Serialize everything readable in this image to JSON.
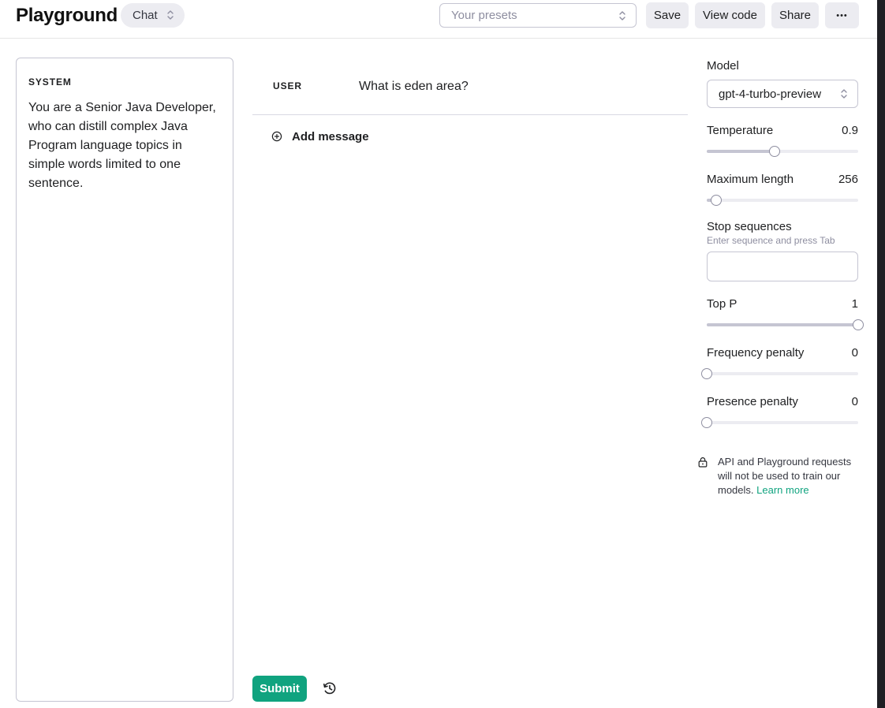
{
  "header": {
    "title": "Playground",
    "mode": "Chat",
    "presets_placeholder": "Your presets",
    "save_label": "Save",
    "view_code_label": "View code",
    "share_label": "Share",
    "more_label": "•••"
  },
  "system": {
    "label": "SYSTEM",
    "text": "You are a Senior Java Developer, who can distill complex Java Program language topics in simple words limited to one sentence."
  },
  "messages": [
    {
      "role": "USER",
      "content": "What is eden area?"
    }
  ],
  "add_message_label": "Add message",
  "submit_label": "Submit",
  "settings": {
    "model_label": "Model",
    "model_value": "gpt-4-turbo-preview",
    "temperature": {
      "label": "Temperature",
      "value": "0.9",
      "fraction": 0.45
    },
    "max_length": {
      "label": "Maximum length",
      "value": "256",
      "fraction": 0.06
    },
    "stop_sequences": {
      "label": "Stop sequences",
      "hint": "Enter sequence and press Tab"
    },
    "top_p": {
      "label": "Top P",
      "value": "1",
      "fraction": 1.0
    },
    "frequency_penalty": {
      "label": "Frequency penalty",
      "value": "0",
      "fraction": 0.0
    },
    "presence_penalty": {
      "label": "Presence penalty",
      "value": "0",
      "fraction": 0.0
    }
  },
  "privacy": {
    "text": "API and Playground requests will not be used to train our models.",
    "link": "Learn more"
  },
  "colors": {
    "accent": "#10a37f",
    "border": "#c5c5d2",
    "button_bg": "#ececf1"
  },
  "icons": {
    "mode": "chevron-updown-icon",
    "presets": "chevron-updown-icon",
    "model": "chevron-updown-icon",
    "add_message": "plus-circle-icon",
    "history": "history-icon",
    "privacy": "lock-icon"
  }
}
